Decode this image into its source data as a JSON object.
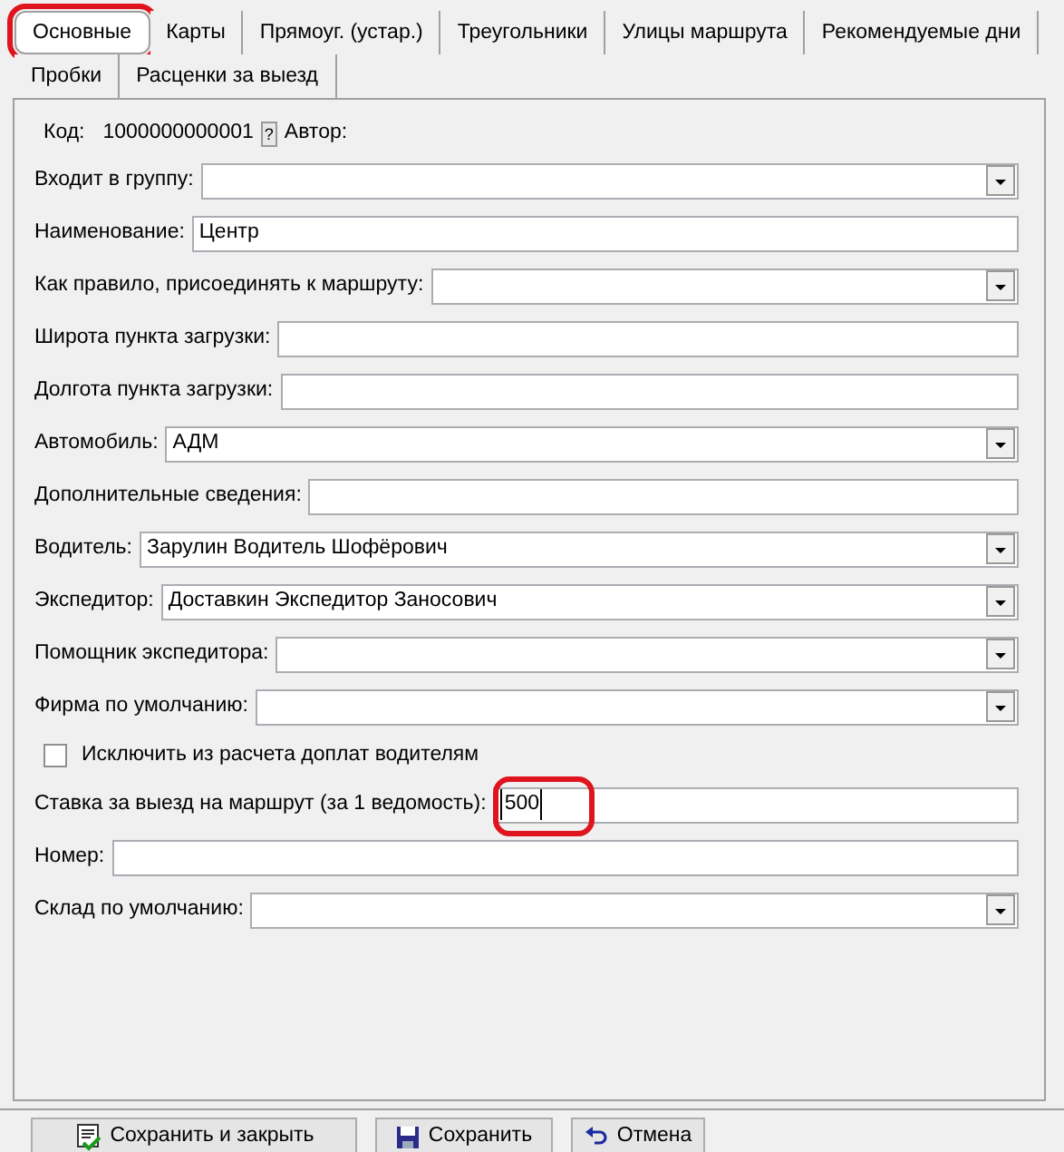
{
  "tabs": [
    {
      "label": "Основные",
      "selected": true,
      "circled": true
    },
    {
      "label": "Карты",
      "selected": false,
      "circled": false
    },
    {
      "label": "Прямоуг. (устар.)",
      "selected": false,
      "circled": false
    },
    {
      "label": "Треугольники",
      "selected": false,
      "circled": false
    },
    {
      "label": "Улицы маршрута",
      "selected": false,
      "circled": false
    },
    {
      "label": "Рекомендуемые дни",
      "selected": false,
      "circled": false
    },
    {
      "label": "Пробки",
      "selected": false,
      "circled": false
    },
    {
      "label": "Расценки за выезд",
      "selected": false,
      "circled": false
    }
  ],
  "code_row": {
    "label": "Код:",
    "value": "1000000000001",
    "help": "?",
    "author_label": "Автор:"
  },
  "fields": [
    {
      "kind": "combo",
      "label": "Входит в группу:",
      "circled": false
    },
    {
      "kind": "text",
      "label": "Наименование:",
      "value": "Центр",
      "circled": false
    },
    {
      "kind": "combo",
      "label": "Как правило, присоединять к маршруту:",
      "circled": false
    },
    {
      "kind": "text",
      "label": "Широта пункта загрузки:",
      "circled": false
    },
    {
      "kind": "text",
      "label": "Долгота пункта загрузки:",
      "circled": false
    },
    {
      "kind": "combo",
      "label": "Автомобиль:",
      "value": "АДМ",
      "circled": false
    },
    {
      "kind": "text",
      "label": "Дополнительные сведения:",
      "circled": false
    },
    {
      "kind": "combo",
      "label": "Водитель:",
      "value": "Зарулин Водитель Шофёрович",
      "circled": false
    },
    {
      "kind": "combo",
      "label": "Экспедитор:",
      "value": "Доставкин Экспедитор Заносович",
      "circled": false
    },
    {
      "kind": "combo",
      "label": "Помощник экспедитора:",
      "circled": false
    },
    {
      "kind": "combo",
      "label": "Фирма по умолчанию:",
      "circled": false
    },
    {
      "kind": "checkbox",
      "label": "Исключить из расчета доплат водителям",
      "checked": false
    },
    {
      "kind": "text",
      "label": "Ставка за выезд на маршрут (за 1 ведомость):",
      "value": "500",
      "circled": true
    },
    {
      "kind": "text",
      "label": "Номер:",
      "circled": false
    },
    {
      "kind": "combo",
      "label": "Склад по умолчанию:",
      "circled": false
    }
  ],
  "buttons": [
    {
      "kind": "save_close",
      "label": "Сохранить и закрыть"
    },
    {
      "kind": "save",
      "label": "Сохранить"
    },
    {
      "kind": "cancel",
      "label": "Отмена"
    }
  ]
}
